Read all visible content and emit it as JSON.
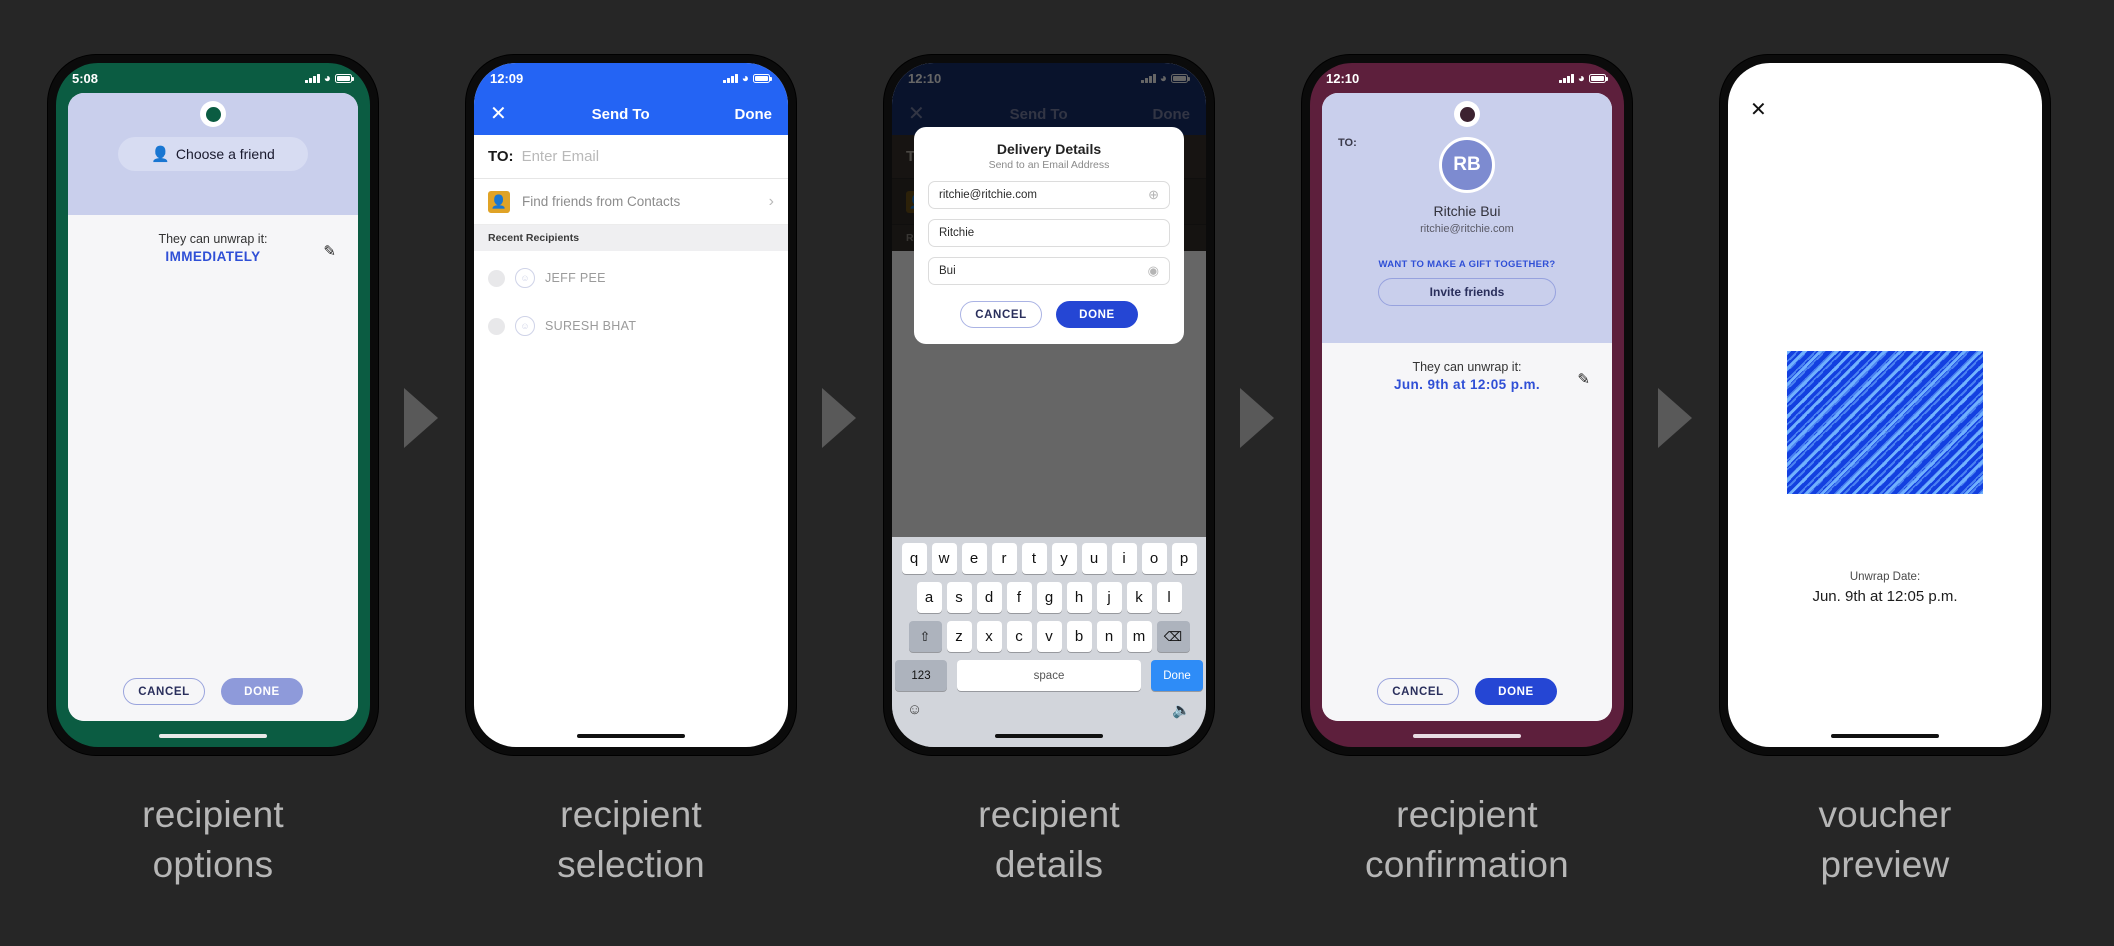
{
  "board": {
    "background": "#262626",
    "arrow_color": "#595959"
  },
  "captions": [
    {
      "line1": "recipient",
      "line2": "options"
    },
    {
      "line1": "recipient",
      "line2": "selection"
    },
    {
      "line1": "recipient",
      "line2": "details"
    },
    {
      "line1": "recipient",
      "line2": "confirmation"
    },
    {
      "line1": "voucher",
      "line2": "preview"
    }
  ],
  "phone1": {
    "bezel_color": "#0b5c42",
    "status": {
      "time": "5:08",
      "location_icon": "location-arrow",
      "signal": "signal-bars",
      "wifi": "wifi",
      "battery": "battery-full"
    },
    "choose_friend_label": "Choose a friend",
    "choose_friend_icon": "person-icon",
    "unwrap_label": "They can unwrap it:",
    "unwrap_value": "IMMEDIATELY",
    "edit_icon": "pencil-icon",
    "cancel_label": "CANCEL",
    "done_label": "DONE",
    "accent": "#2f4fd6",
    "card_head_color": "#c9cfec"
  },
  "phone2": {
    "bezel_color": "#0b0b0b",
    "status": {
      "time": "12:09"
    },
    "nav": {
      "close_icon": "close-icon",
      "title": "Send To",
      "done_label": "Done",
      "bar_color": "#2464f4"
    },
    "to_label": "TO:",
    "to_placeholder": "Enter Email",
    "contacts_row_label": "Find friends from Contacts",
    "contacts_icon": "contacts-icon",
    "chevron_icon": "chevron-right-icon",
    "section_label": "Recent Recipients",
    "recents": [
      {
        "name": "JEFF PEE"
      },
      {
        "name": "SURESH BHAT"
      }
    ]
  },
  "phone3": {
    "bezel_color": "#0b0b0b",
    "status": {
      "time": "12:10"
    },
    "nav": {
      "close_icon": "close-icon",
      "title": "Send To",
      "done_label": "Done"
    },
    "to_label": "TO:",
    "section_label": "Rec",
    "dialog": {
      "title": "Delivery Details",
      "subtitle": "Send to an Email Address",
      "email_value": "ritchie@ritchie.com",
      "email_action_icon": "plus-circle-icon",
      "first_name_value": "Ritchie",
      "last_name_value": "Bui",
      "last_name_clear_icon": "clear-circle-icon",
      "cancel_label": "CANCEL",
      "done_label": "DONE"
    },
    "keyboard": {
      "row1": [
        "q",
        "w",
        "e",
        "r",
        "t",
        "y",
        "u",
        "i",
        "o",
        "p"
      ],
      "row2": [
        "a",
        "s",
        "d",
        "f",
        "g",
        "h",
        "j",
        "k",
        "l"
      ],
      "row3": [
        "z",
        "x",
        "c",
        "v",
        "b",
        "n",
        "m"
      ],
      "shift_icon": "shift-icon",
      "backspace_icon": "backspace-icon",
      "numbers_label": "123",
      "space_label": "space",
      "return_label": "Done",
      "emoji_icon": "emoji-icon",
      "mic_icon": "microphone-icon"
    }
  },
  "phone4": {
    "bezel_color": "#5d1f3c",
    "status": {
      "time": "12:10"
    },
    "to_label": "TO:",
    "avatar_initials": "RB",
    "recipient_name": "Ritchie Bui",
    "recipient_email": "ritchie@ritchie.com",
    "gift_prompt": "WANT TO MAKE A GIFT TOGETHER?",
    "invite_label": "Invite friends",
    "unwrap_label": "They can unwrap it:",
    "unwrap_value": "Jun. 9th at 12:05 p.m.",
    "edit_icon": "pencil-icon",
    "cancel_label": "CANCEL",
    "done_label": "DONE"
  },
  "phone5": {
    "bezel_color": "#0b0b0b",
    "close_icon": "close-icon",
    "envelope_icon": "envelope-graphic",
    "envelope_color": "#1340e0",
    "unwrap_label": "Unwrap Date:",
    "unwrap_value": "Jun. 9th at 12:05 p.m."
  }
}
